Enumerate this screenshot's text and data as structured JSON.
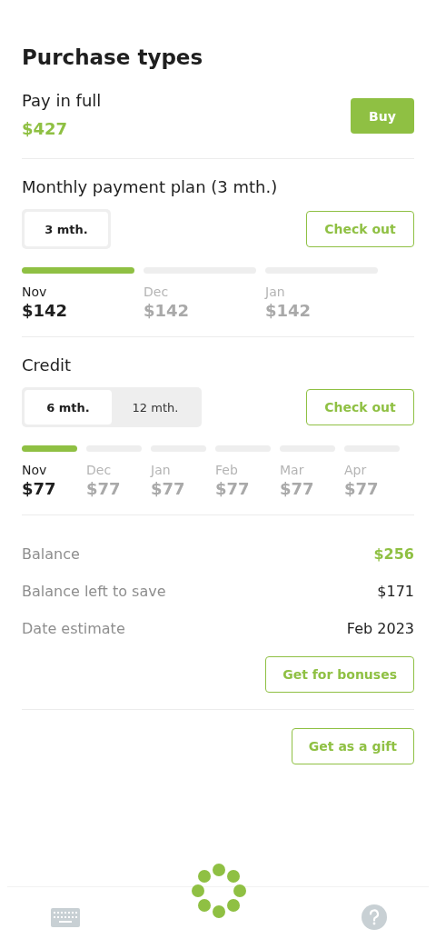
{
  "title": "Purchase types",
  "full": {
    "label": "Pay in full",
    "price": "$427",
    "button": "Buy"
  },
  "monthly": {
    "title": "Monthly payment plan (3 mth.)",
    "tabs": [
      {
        "label": "3 mth.",
        "selected": true
      }
    ],
    "button": "Check out",
    "installments": [
      {
        "month": "Nov",
        "amount": "$142",
        "active": true
      },
      {
        "month": "Dec",
        "amount": "$142",
        "active": false
      },
      {
        "month": "Jan",
        "amount": "$142",
        "active": false
      }
    ]
  },
  "credit": {
    "title": "Credit",
    "tabs": [
      {
        "label": "6 mth.",
        "selected": true
      },
      {
        "label": "12 mth.",
        "selected": false
      }
    ],
    "button": "Check out",
    "installments": [
      {
        "month": "Nov",
        "amount": "$77",
        "active": true
      },
      {
        "month": "Dec",
        "amount": "$77",
        "active": false
      },
      {
        "month": "Jan",
        "amount": "$77",
        "active": false
      },
      {
        "month": "Feb",
        "amount": "$77",
        "active": false
      },
      {
        "month": "Mar",
        "amount": "$77",
        "active": false
      },
      {
        "month": "Apr",
        "amount": "$77",
        "active": false
      }
    ]
  },
  "summary": [
    {
      "label": "Balance",
      "value": "$256",
      "kind": "highlight"
    },
    {
      "label": "Balance left to save",
      "value": "$171",
      "kind": "plain"
    },
    {
      "label": "Date estimate",
      "value": "Feb 2023",
      "kind": "plain"
    }
  ],
  "bonus_button": "Get for bonuses",
  "gift_button": "Get as a gift"
}
